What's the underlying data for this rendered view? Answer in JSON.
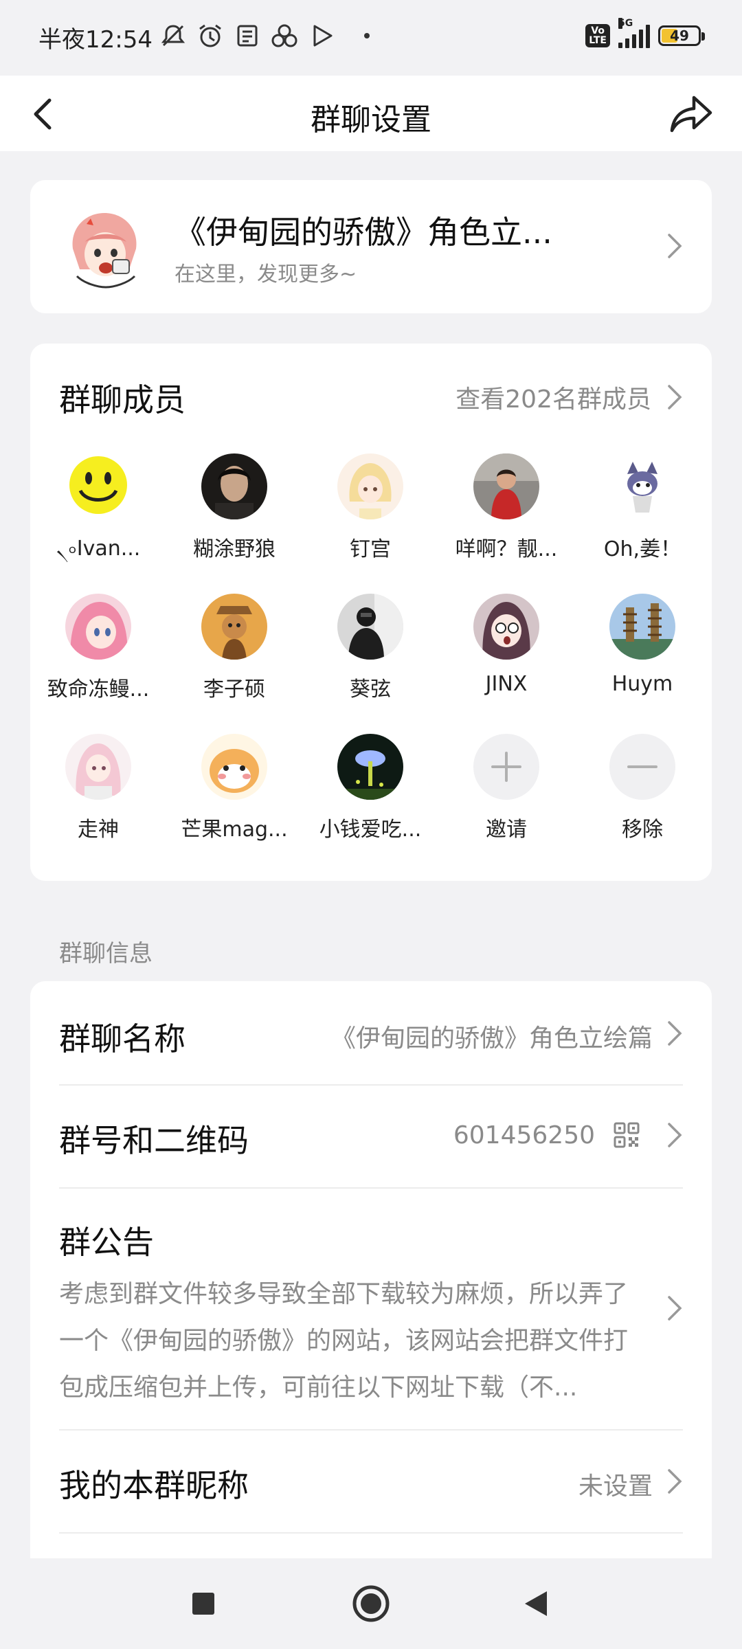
{
  "status": {
    "time": "半夜12:54",
    "volte": "Vo\nLTE",
    "network": "5G",
    "battery": "49",
    "battery_level": 0.49
  },
  "header": {
    "title": "群聊设置",
    "back_icon": "back-arrow-icon",
    "share_icon": "share-icon"
  },
  "group": {
    "name": "《伊甸园的骄傲》角色立...",
    "subtitle": "在这里，发现更多~"
  },
  "members": {
    "title": "群聊成员",
    "view_all": "查看202名群成员",
    "items": [
      {
        "name": "৲৹Ivan..."
      },
      {
        "name": "糊涂野狼"
      },
      {
        "name": "钉宫"
      },
      {
        "name": "咩啊？靓..."
      },
      {
        "name": "Oh,姜！"
      },
      {
        "name": "致命冻鳗..."
      },
      {
        "name": "李子硕"
      },
      {
        "name": "葵弦"
      },
      {
        "name": "JINX"
      },
      {
        "name": "Huym"
      },
      {
        "name": "走神"
      },
      {
        "name": "芒果mag..."
      },
      {
        "name": "小钱爱吃..."
      },
      {
        "name": "邀请"
      },
      {
        "name": "移除"
      }
    ]
  },
  "info": {
    "section_label": "群聊信息",
    "name_label": "群聊名称",
    "name_value": "《伊甸园的骄傲》角色立绘篇",
    "id_label": "群号和二维码",
    "id_value": "601456250",
    "notice_label": "群公告",
    "notice_text": "考虑到群文件较多导致全部下载较为麻烦，所以弄了一个《伊甸园的骄傲》的网站，该网站会把群文件打包成压缩包并上传，可前往以下网址下载（不...",
    "nickname_label": "我的本群昵称",
    "nickname_value": "未设置"
  },
  "colors": {
    "background": "#f2f2f4",
    "card": "#ffffff",
    "secondary_text": "#8a8a8a"
  }
}
